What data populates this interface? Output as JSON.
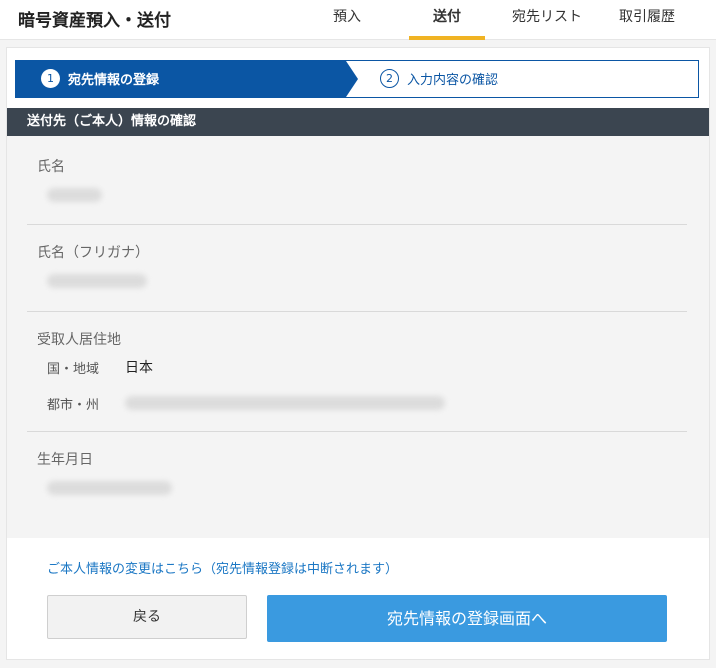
{
  "header": {
    "title": "暗号資産預入・送付",
    "tabs": [
      {
        "label": "預入",
        "active": false
      },
      {
        "label": "送付",
        "active": true
      },
      {
        "label": "宛先リスト",
        "active": false
      },
      {
        "label": "取引履歴",
        "active": false
      }
    ],
    "active_color": "#f0b323"
  },
  "stepper": {
    "steps": [
      {
        "number": "1",
        "label": "宛先情報の登録",
        "active": true
      },
      {
        "number": "2",
        "label": "入力内容の確認",
        "active": false
      }
    ],
    "active_color": "#0b56a4"
  },
  "section": {
    "title": "送付先（ご本人）情報の確認",
    "fields": {
      "name_label": "氏名",
      "kana_label": "氏名（フリガナ）",
      "address_label": "受取人居住地",
      "country_label": "国・地域",
      "country_value": "日本",
      "state_label": "都市・州",
      "birthdate_label": "生年月日"
    }
  },
  "links": {
    "change_personal_info": "ご本人情報の変更はこちら（宛先情報登録は中断されます）"
  },
  "buttons": {
    "back": "戻る",
    "next": "宛先情報の登録画面へ",
    "next_color": "#3a9ae0"
  }
}
